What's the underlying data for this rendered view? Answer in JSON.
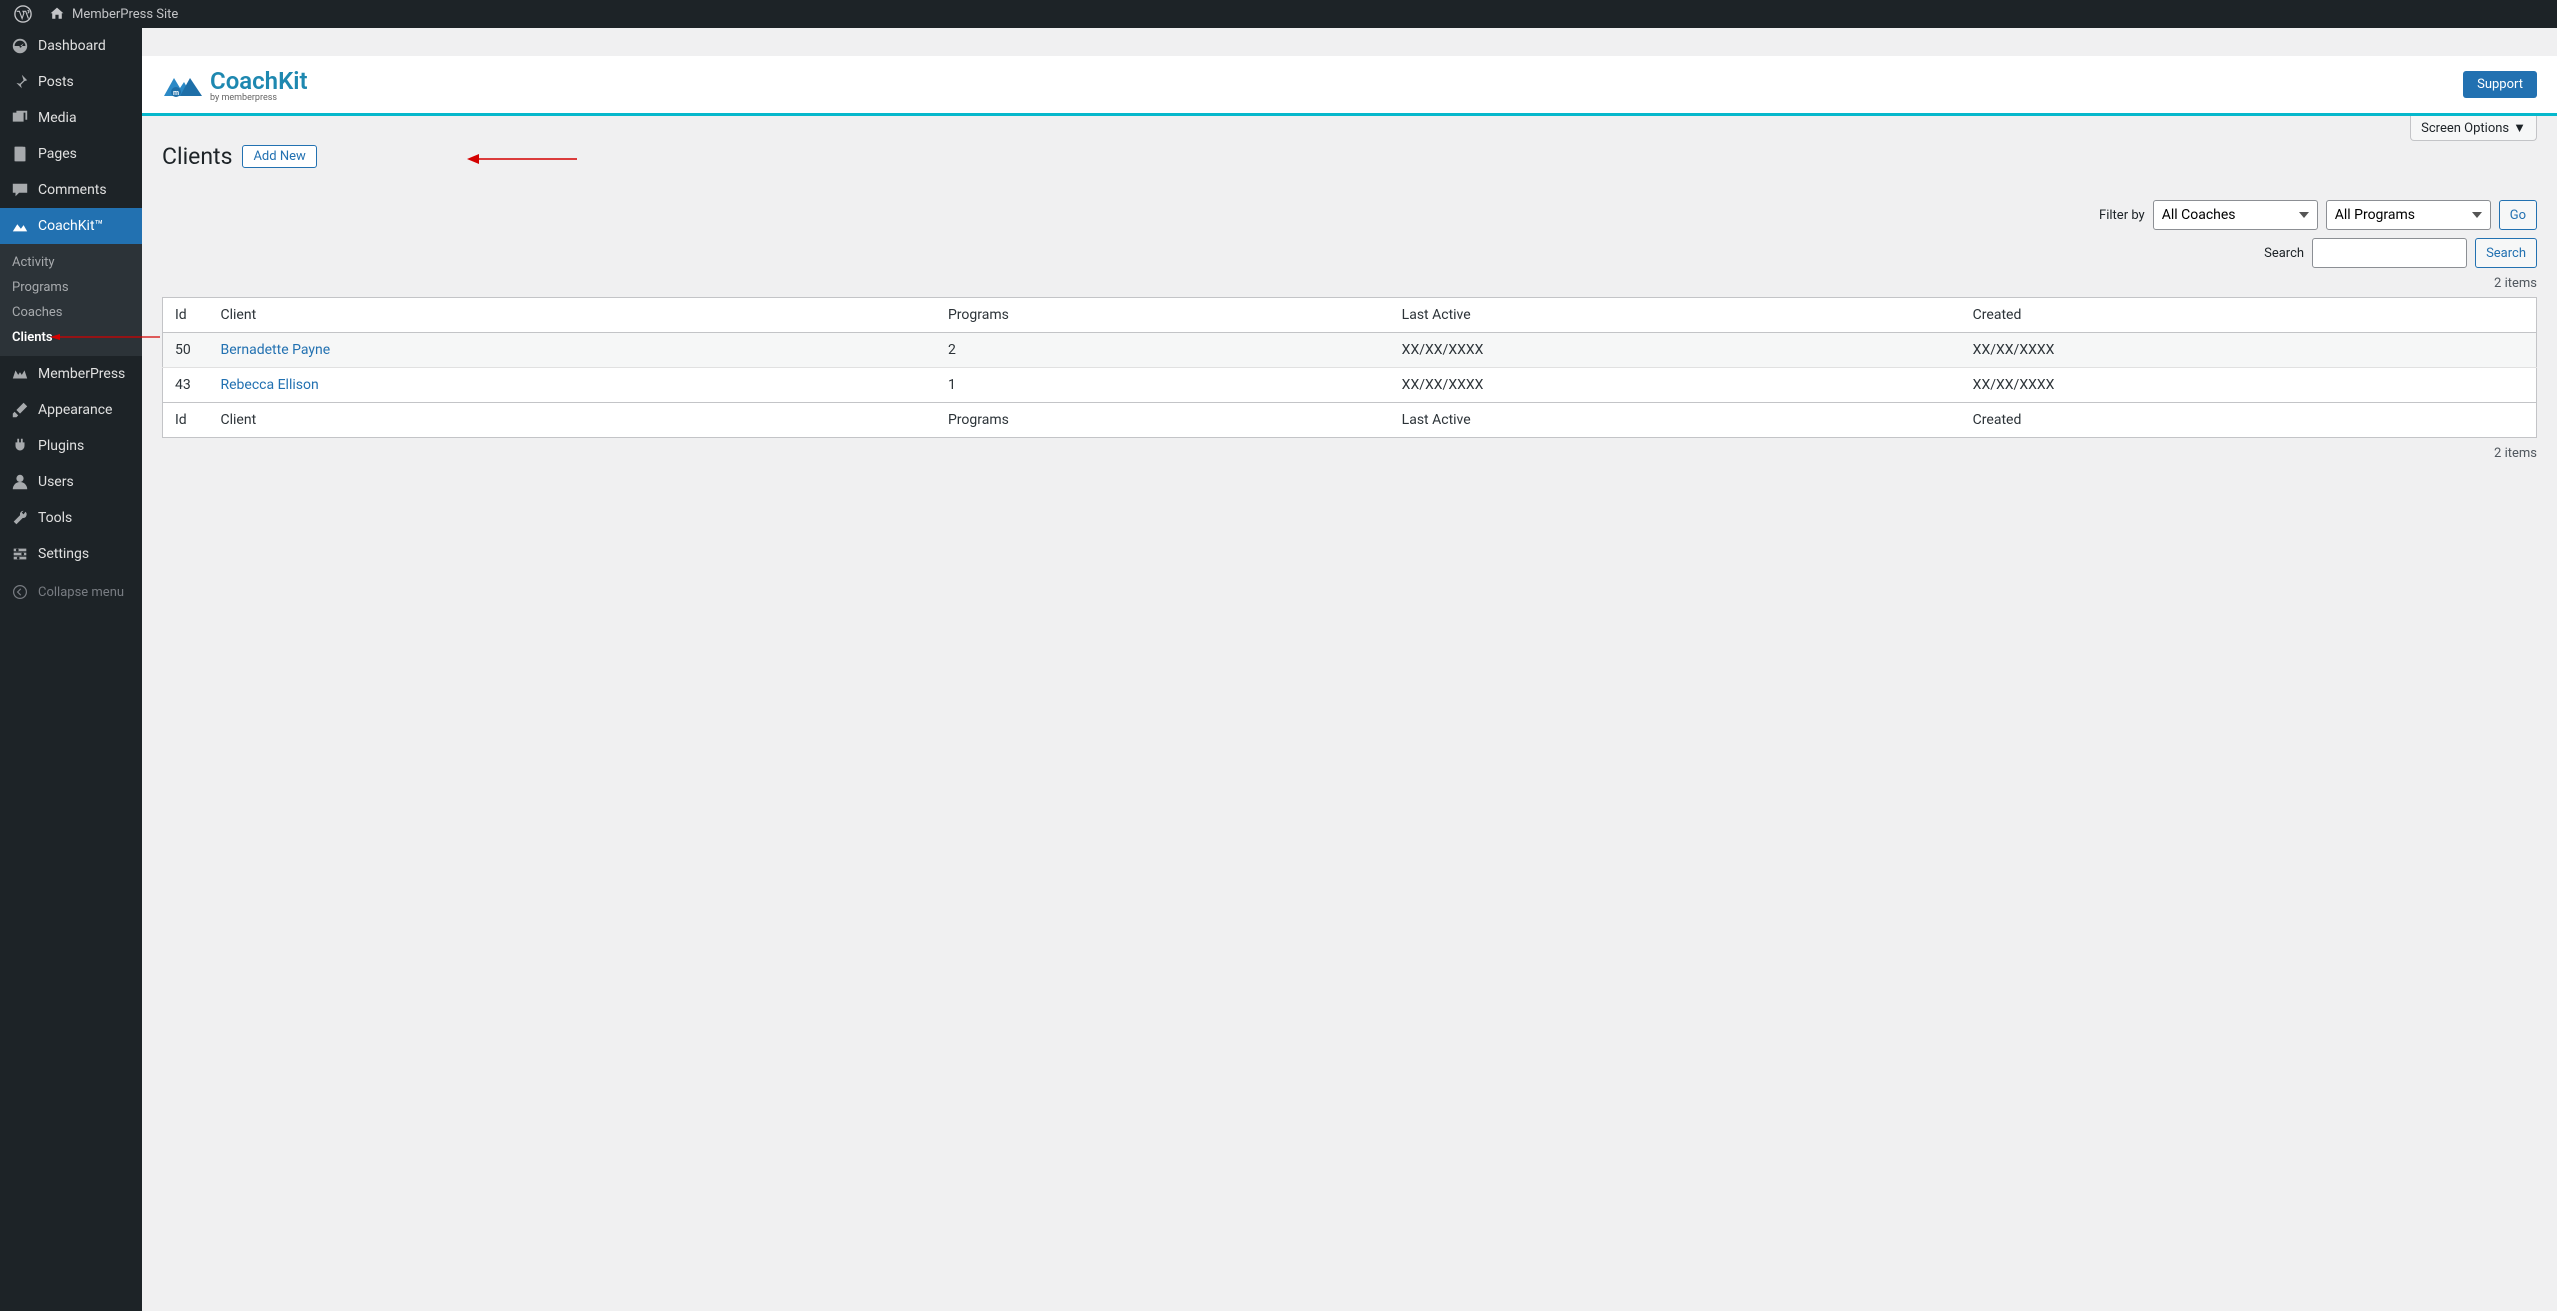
{
  "admin_bar": {
    "site_name": "MemberPress Site"
  },
  "sidebar": {
    "items": [
      {
        "label": "Dashboard",
        "icon": "dashboard"
      },
      {
        "label": "Posts",
        "icon": "pin"
      },
      {
        "label": "Media",
        "icon": "media"
      },
      {
        "label": "Pages",
        "icon": "pages"
      },
      {
        "label": "Comments",
        "icon": "comment"
      }
    ],
    "active": {
      "label": "CoachKit™",
      "icon": "chart"
    },
    "submenu": [
      {
        "label": "Activity"
      },
      {
        "label": "Programs"
      },
      {
        "label": "Coaches"
      },
      {
        "label": "Clients",
        "current": true
      }
    ],
    "after": [
      {
        "label": "MemberPress",
        "icon": "mp"
      },
      {
        "label": "Appearance",
        "icon": "brush"
      },
      {
        "label": "Plugins",
        "icon": "plug"
      },
      {
        "label": "Users",
        "icon": "user"
      },
      {
        "label": "Tools",
        "icon": "wrench"
      },
      {
        "label": "Settings",
        "icon": "settings"
      }
    ],
    "collapse": "Collapse menu"
  },
  "header": {
    "logo_text": "CoachKit",
    "sublogo": "by memberpress",
    "support": "Support"
  },
  "page": {
    "screen_options": "Screen Options",
    "title": "Clients",
    "add_new": "Add New"
  },
  "filters": {
    "label": "Filter by",
    "coaches": "All Coaches",
    "programs": "All Programs",
    "go": "Go"
  },
  "search": {
    "label": "Search",
    "button": "Search"
  },
  "list": {
    "count": "2 items",
    "columns": {
      "id": "Id",
      "client": "Client",
      "programs": "Programs",
      "last_active": "Last Active",
      "created": "Created"
    },
    "rows": [
      {
        "id": "50",
        "client": "Bernadette Payne",
        "programs": "2",
        "last_active": "XX/XX/XXXX",
        "created": "XX/XX/XXXX"
      },
      {
        "id": "43",
        "client": "Rebecca Ellison",
        "programs": "1",
        "last_active": "XX/XX/XXXX",
        "created": "XX/XX/XXXX"
      }
    ]
  }
}
